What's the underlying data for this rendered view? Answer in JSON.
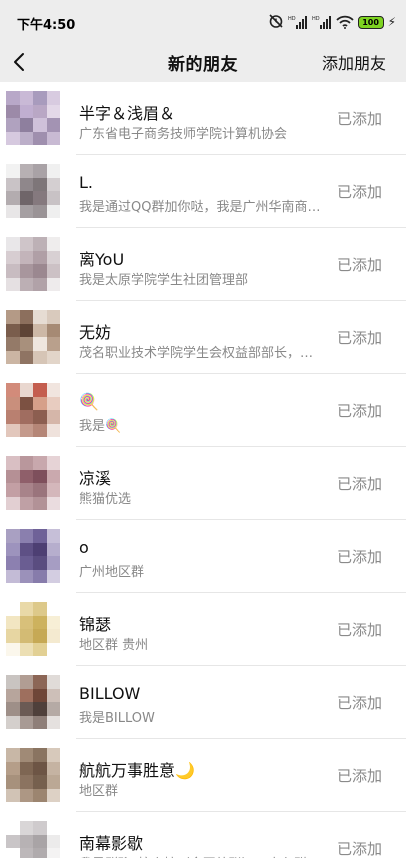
{
  "status_bar": {
    "time": "下午4:50",
    "signal_label_1": "HD",
    "signal_label_2": "HD",
    "battery_level": "100"
  },
  "nav": {
    "title": "新的朋友",
    "action_label": "添加朋友"
  },
  "friends": [
    {
      "name": "半字＆浅眉＆",
      "desc": "广东省电子商务技师学院计算机协会",
      "status": "已添加",
      "avatar_colors": [
        "#b8a8c8",
        "#c9b9d6",
        "#a89bbd",
        "#d8cbe0",
        "#9c8aa8",
        "#c0aed0",
        "#b9a7c5",
        "#e3d8e8",
        "#b0a2bf",
        "#8e7f9e",
        "#cfc1da",
        "#a393b3",
        "#d6c9df",
        "#bcafc9",
        "#9f8fae",
        "#c8bad3"
      ]
    },
    {
      "name": "L.",
      "desc": "我是通过QQ群加你哒，我是广州华南商贸职业学院",
      "status": "已添加",
      "avatar_colors": [
        "#f2f2f2",
        "#b7b0b3",
        "#a9a2a6",
        "#f0f0f0",
        "#c9c3c6",
        "#8f878b",
        "#7e7679",
        "#d4cfd1",
        "#b3acaf",
        "#6f6569",
        "#85797e",
        "#c8c2c5",
        "#e8e6e7",
        "#a59fa2",
        "#9a9396",
        "#efefef"
      ]
    },
    {
      "name": "离YoU",
      "desc": "我是太原学院学生社团管理部",
      "status": "已添加",
      "avatar_colors": [
        "#e9e7e9",
        "#cfc5c9",
        "#bdb1b6",
        "#efeded",
        "#d7cdd1",
        "#c3b4ba",
        "#b09fa6",
        "#d8d0d3",
        "#c8bcc1",
        "#a8969d",
        "#9b8890",
        "#ccc1c5",
        "#e5e0e2",
        "#bcafb4",
        "#b1a2a8",
        "#eeebec"
      ]
    },
    {
      "name": "无妨",
      "desc": "茂名职业技术学院学生会权益部部长，来收集信息",
      "status": "已添加",
      "avatar_colors": [
        "#b49a86",
        "#8c6f5d",
        "#e6dcd3",
        "#d9cabd",
        "#7a5d4c",
        "#5e4436",
        "#cdb8a6",
        "#a68a74",
        "#947a68",
        "#a8907c",
        "#efe6de",
        "#b9a08c",
        "#cbb5a3",
        "#8f7463",
        "#d6c5b6",
        "#e2d5c9"
      ]
    },
    {
      "name": "🍭",
      "desc": "我是🍭",
      "status": "已添加",
      "avatar_colors": [
        "#d28b7a",
        "#e9d7cf",
        "#c45e4f",
        "#f1e5df",
        "#c98f7c",
        "#7c5142",
        "#d6a08a",
        "#e8ccc0",
        "#b98070",
        "#a06d60",
        "#8c5e50",
        "#d5b6a9",
        "#e2c7bc",
        "#c49a8c",
        "#b58677",
        "#efe2dc"
      ]
    },
    {
      "name": "凉溪",
      "desc": "熊猫优选",
      "status": "已添加",
      "avatar_colors": [
        "#d9bfc3",
        "#b9979c",
        "#c8a8ad",
        "#e6d3d6",
        "#b59095",
        "#8f5f6a",
        "#7e4f5c",
        "#caa9ae",
        "#c39fa4",
        "#a8838a",
        "#9a747c",
        "#d4b7bb",
        "#e2cfd2",
        "#bfa0a5",
        "#b29297",
        "#eadcdf"
      ]
    },
    {
      "name": "o",
      "desc": "广州地区群",
      "status": "已添加",
      "avatar_colors": [
        "#a9a0c2",
        "#8a7fae",
        "#6f6298",
        "#c6bfd8",
        "#9d93bd",
        "#5e5085",
        "#4d3f73",
        "#b6aecd",
        "#8c80b0",
        "#6a5d92",
        "#5a4d80",
        "#a69dc3",
        "#c3bbd6",
        "#9b91ba",
        "#877cab",
        "#d3cde1"
      ]
    },
    {
      "name": "锦瑟",
      "desc": "地区群 贵州",
      "status": "已添加",
      "avatar_colors": [
        "#ffffff",
        "#e9d9a8",
        "#ddc98a",
        "#ffffff",
        "#f2e6c2",
        "#d8c07a",
        "#cdb25e",
        "#f7efd6",
        "#e7d6a2",
        "#d3bb74",
        "#c6a955",
        "#f4ead0",
        "#fbf7ec",
        "#ecdfb4",
        "#e2d094",
        "#ffffff"
      ]
    },
    {
      "name": "BILLOW",
      "desc": "我是BILLOW",
      "status": "已添加",
      "avatar_colors": [
        "#c9c4c1",
        "#b19d93",
        "#8c6656",
        "#e0dbd8",
        "#b7a59c",
        "#9e6f5e",
        "#6f4638",
        "#cdbfb8",
        "#9e8f88",
        "#6b5a54",
        "#4f403b",
        "#b5aaa5",
        "#d4cfcc",
        "#a89a94",
        "#8e7e78",
        "#e5e1df"
      ]
    },
    {
      "name": "航航万事胜意🌙",
      "desc": "地区群",
      "status": "已添加",
      "avatar_colors": [
        "#c8b7a6",
        "#a08a76",
        "#8a7461",
        "#d7c9bb",
        "#b59e89",
        "#7e6653",
        "#6d5545",
        "#c5b3a2",
        "#a7917c",
        "#8b7360",
        "#76604e",
        "#bba895",
        "#d1c3b5",
        "#ad9784",
        "#9c8570",
        "#ddd1c5"
      ]
    },
    {
      "name": "南幕影歇",
      "desc": "我是群聊“校介榜（全国外联）二十九群”的南幕影歇",
      "status": "已添加",
      "avatar_colors": [
        "#ffffff",
        "#d9d6d7",
        "#cfcbcd",
        "#ffffff",
        "#c9c5c7",
        "#b7b2b4",
        "#a9a4a6",
        "#ecebeb",
        "#ffffff",
        "#bdb8ba",
        "#b0abad",
        "#f4f3f3",
        "#ffffff",
        "#e0dddf",
        "#d6d3d4",
        "#ffffff"
      ]
    }
  ]
}
